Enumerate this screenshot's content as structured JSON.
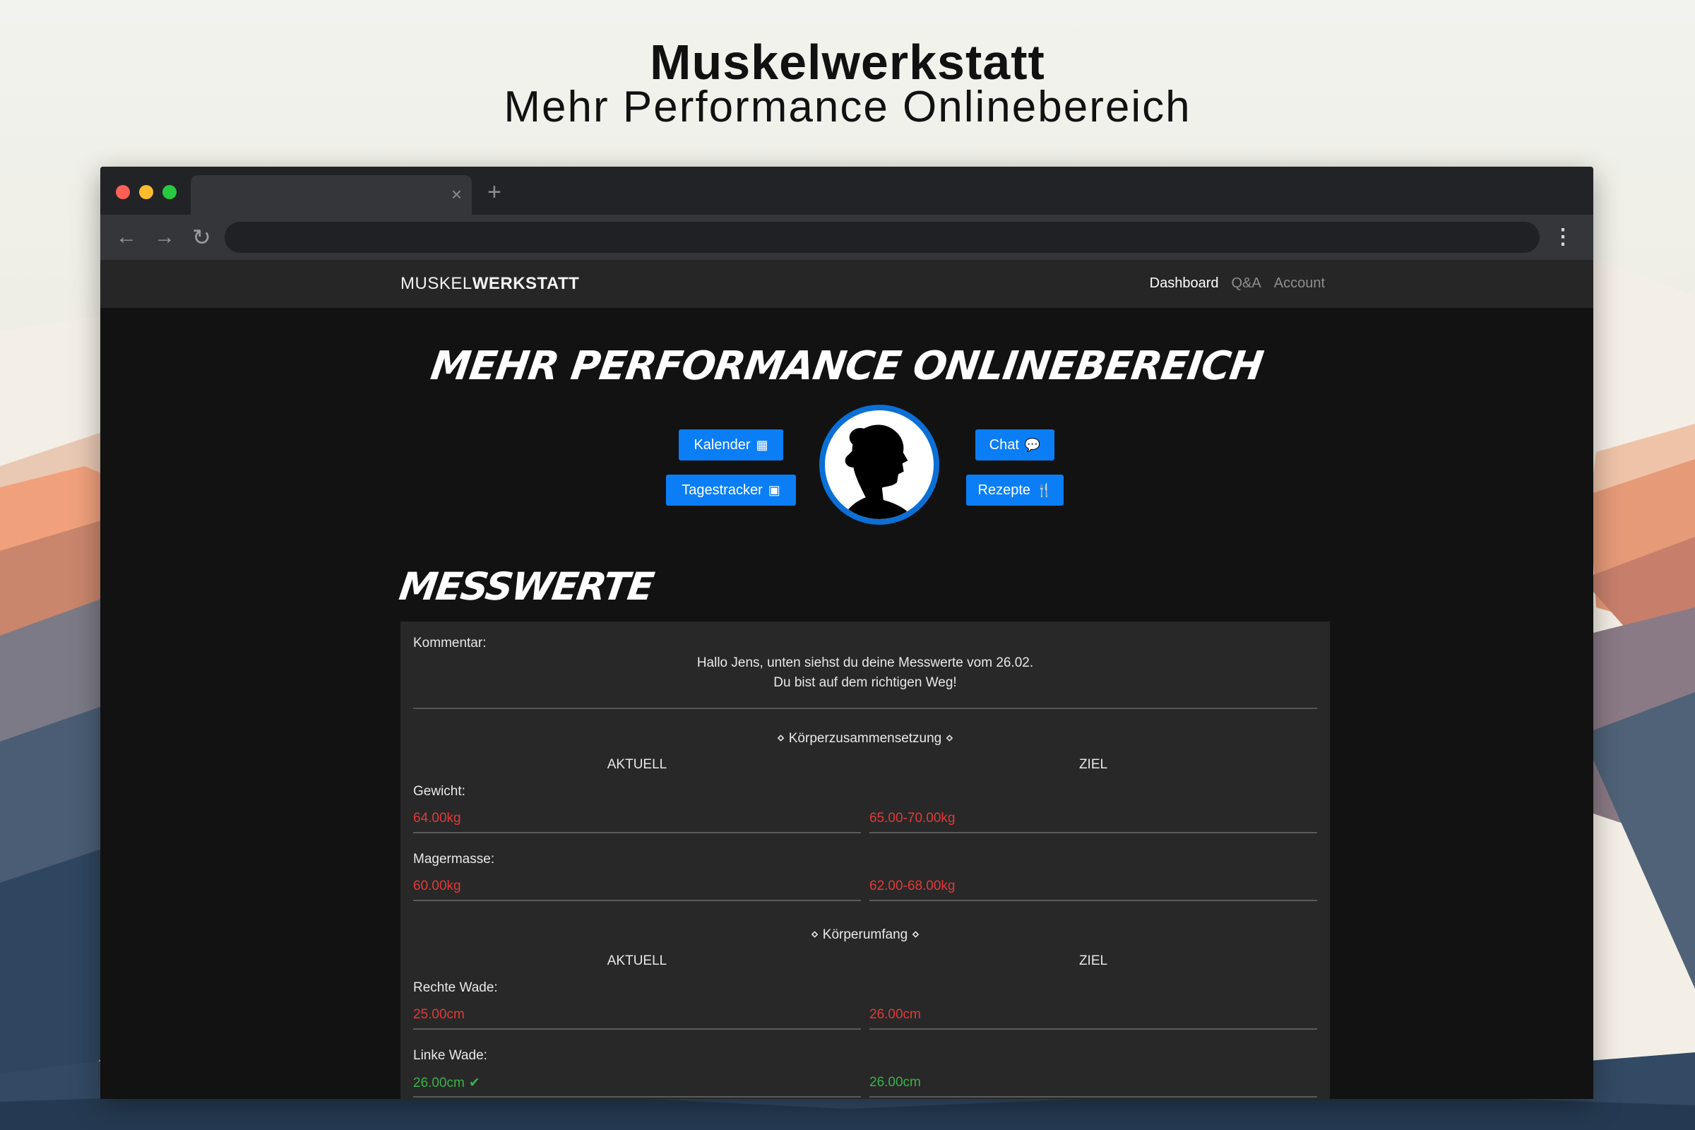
{
  "hero": {
    "title": "Muskelwerkstatt",
    "subtitle": "Mehr Performance Onlinebereich"
  },
  "browser": {
    "tab_close": "×",
    "new_tab": "+",
    "back": "←",
    "forward": "→",
    "reload": "↻",
    "menu": "⋮"
  },
  "site": {
    "brand_light": "MUSKEL",
    "brand_bold": "WERKSTATT",
    "nav": [
      {
        "label": "Dashboard"
      },
      {
        "label": "Q&A"
      },
      {
        "label": "Account"
      }
    ],
    "page_title": "Mehr Performance Onlinebereich",
    "buttons": {
      "kalender": "Kalender",
      "tagestracker": "Tagestracker",
      "chat": "Chat",
      "rezepte": "Rezepte"
    },
    "icons": {
      "calendar": "▦",
      "tracker": "▣",
      "chat": "💬",
      "utensils": "🍴"
    }
  },
  "messwerte": {
    "title": "Messwerte",
    "comment_label": "Kommentar:",
    "comment_line1": "Hallo Jens, unten siehst du deine Messwerte vom 26.02.",
    "comment_line2": "Du bist auf dem richtigen Weg!",
    "sections": [
      {
        "title": "⋄ Körperzusammensetzung ⋄",
        "col_current": "AKTUELL",
        "col_target": "ZIEL",
        "rows": [
          {
            "label": "Gewicht:",
            "current": "64.00kg",
            "target": "65.00-70.00kg",
            "status": "red"
          },
          {
            "label": "Magermasse:",
            "current": "60.00kg",
            "target": "62.00-68.00kg",
            "status": "red"
          }
        ]
      },
      {
        "title": "⋄ Körperumfang ⋄",
        "col_current": "AKTUELL",
        "col_target": "ZIEL",
        "rows": [
          {
            "label": "Rechte Wade:",
            "current": "25.00cm",
            "target": "26.00cm",
            "status": "red"
          },
          {
            "label": "Linke Wade:",
            "current": "26.00cm",
            "target": "26.00cm",
            "status": "green",
            "check": "✔"
          }
        ]
      }
    ]
  },
  "colors": {
    "accent": "#0b7ef5",
    "bad": "#e03a3a",
    "good": "#38b24a"
  }
}
